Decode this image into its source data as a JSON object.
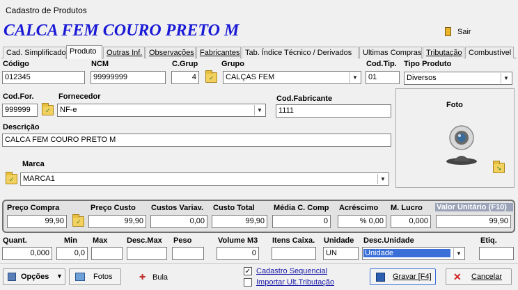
{
  "window": {
    "title": "Cadastro de Produtos"
  },
  "header": {
    "product_name": "CALCA FEM COURO PRETO M",
    "exit_label": "Sair"
  },
  "tabs": [
    {
      "label": "Cad. Simplificado"
    },
    {
      "label": "Produto"
    },
    {
      "label": "Outras Inf."
    },
    {
      "label": "Observações"
    },
    {
      "label": "Fabricantes"
    },
    {
      "label": "Tab. Índice Técnico / Derivados"
    },
    {
      "label": "Ultimas Compras"
    },
    {
      "label": "Tributação"
    },
    {
      "label": "Combustível"
    }
  ],
  "form": {
    "codigo": {
      "label": "Código",
      "value": "012345"
    },
    "ncm": {
      "label": "NCM",
      "value": "99999999"
    },
    "cgrup": {
      "label": "C.Grup",
      "value": "4"
    },
    "grupo": {
      "label": "Grupo",
      "value": "CALÇAS FEM"
    },
    "codtip": {
      "label": "Cod.Tip.",
      "value": "01"
    },
    "tipo_produto": {
      "label": "Tipo Produto",
      "value": "Diversos"
    },
    "codfor": {
      "label": "Cod.For.",
      "value": "999999"
    },
    "fornecedor": {
      "label": "Fornecedor",
      "value": "NF-e"
    },
    "codfabricante": {
      "label": "Cod.Fabricante",
      "value": "1111"
    },
    "descricao": {
      "label": "Descrição",
      "value": "CALCA FEM COURO PRETO M"
    },
    "marca": {
      "label": "Marca",
      "value": "MARCA1"
    },
    "foto": {
      "label": "Foto"
    }
  },
  "prices": {
    "preco_compra": {
      "label": "Preço Compra",
      "value": "99,90"
    },
    "preco_custo": {
      "label": "Preço Custo",
      "value": "99,90"
    },
    "custos_variav": {
      "label": "Custos Variav.",
      "value": "0,00"
    },
    "custo_total": {
      "label": "Custo Total",
      "value": "99,90"
    },
    "media_c_comp": {
      "label": "Média C. Comp",
      "value": "0"
    },
    "acrescimo": {
      "label": "Acréscimo",
      "value": "% 0,00"
    },
    "m_lucro": {
      "label": "M. Lucro",
      "value": "0,000"
    },
    "valor_unitario": {
      "label": "Valor Unitário (F10)",
      "value": "99,90"
    }
  },
  "stock": {
    "quant": {
      "label": "Quant.",
      "value": "0,000"
    },
    "min": {
      "label": "Min",
      "value": "0,0"
    },
    "max": {
      "label": "Max",
      "value": ""
    },
    "desc_max": {
      "label": "Desc.Max",
      "value": ""
    },
    "peso": {
      "label": "Peso",
      "value": ""
    },
    "volume_m3": {
      "label": "Volume M3",
      "value": "0"
    },
    "itens_caixa": {
      "label": "Itens Caixa.",
      "value": ""
    },
    "unidade": {
      "label": "Unidade",
      "value": "UN"
    },
    "desc_unidade": {
      "label": "Desc.Unidade",
      "value": "Unidade"
    },
    "etiq": {
      "label": "Etiq.",
      "value": ""
    }
  },
  "footer": {
    "opcoes": "Opções",
    "fotos": "Fotos",
    "bula": "Bula",
    "cadastro_sequencial": "Cadastro Sequencial",
    "cadastro_sequencial_checked": true,
    "importar_tributacao": "Importar Ult.Tributação",
    "importar_tributacao_checked": false,
    "gravar": "Gravar [F4]",
    "cancelar": "Cancelar"
  },
  "colors": {
    "title_blue": "#1a1ad6",
    "selected_blue": "#3a6fd8",
    "panel_border": "#6f6f6f"
  }
}
